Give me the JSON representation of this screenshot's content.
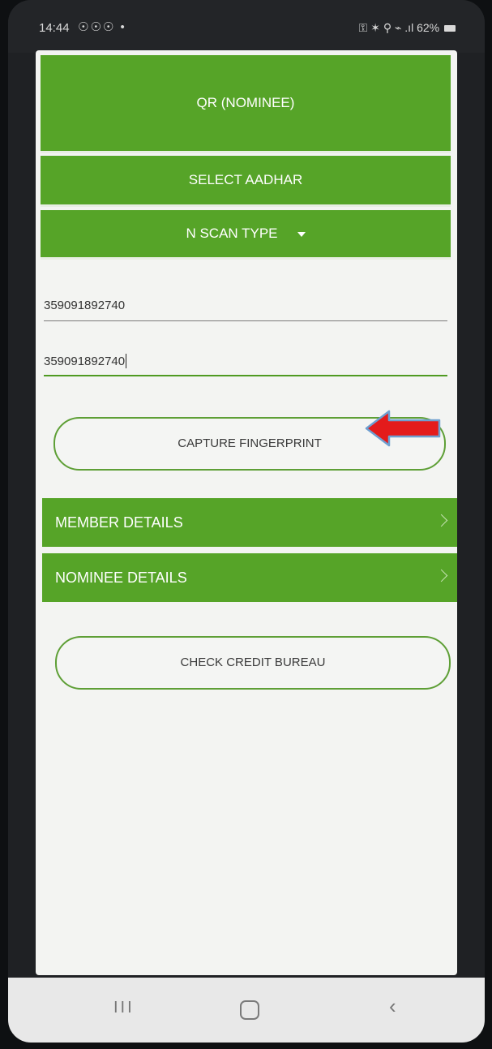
{
  "status": {
    "time": "14:44",
    "notif_icons": "☉☉☉ •",
    "right_icons": "⚿ ✶ ⚲ ⌁ .ıl",
    "battery": "62%"
  },
  "buttons": {
    "qr_nominee": "QR (NOMINEE)",
    "select_aadhar": "SELECT AADHAR",
    "scan_type": "N SCAN TYPE",
    "capture_fingerprint": "CAPTURE FINGERPRINT",
    "check_credit": "CHECK CREDIT BUREAU"
  },
  "fields": {
    "id_1": "359091892740",
    "id_2": "359091892740"
  },
  "sections": {
    "member": "MEMBER DETAILS",
    "nominee": "NOMINEE DETAILS"
  },
  "nav": {
    "recent": "III",
    "back": "‹"
  },
  "colors": {
    "primary_green": "#56a428",
    "annotation_arrow": "#e41b1b"
  }
}
